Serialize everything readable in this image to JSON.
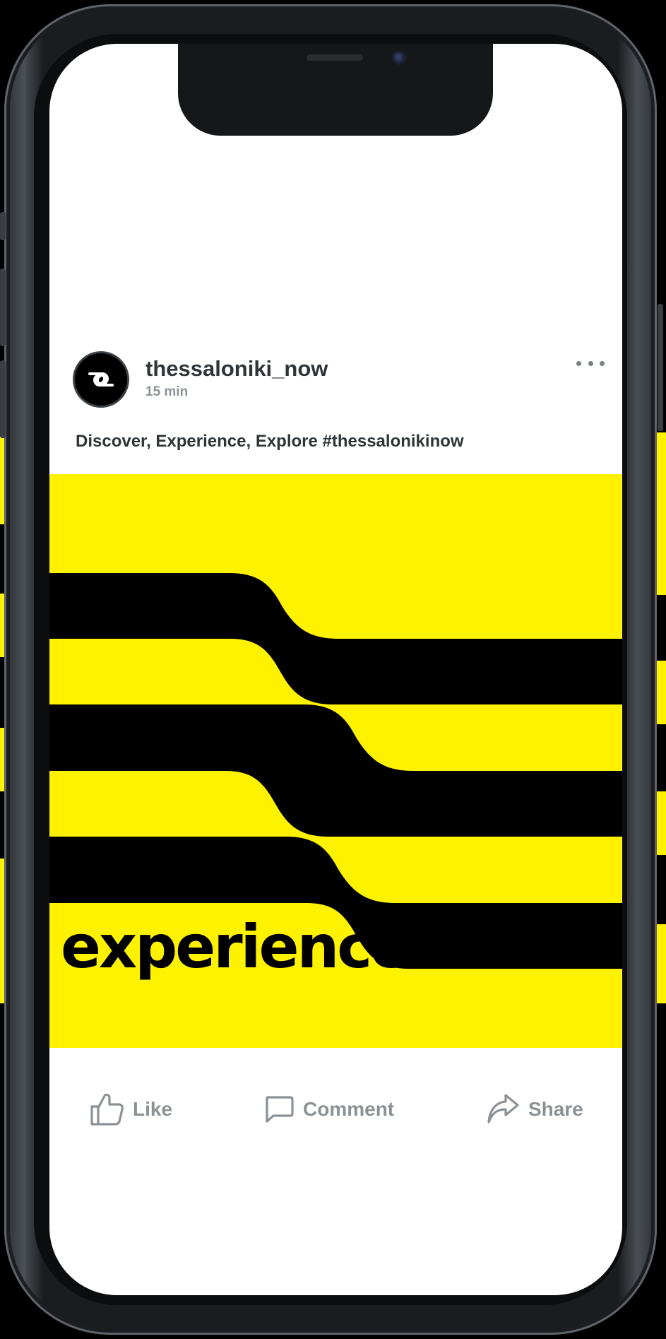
{
  "post": {
    "username": "thessaloniki_now",
    "timestamp": "15 min",
    "caption": "Discover, Experience, Explore #thessalonikinow",
    "image_word": "experience"
  },
  "actions": {
    "like_label": "Like",
    "comment_label": "Comment",
    "share_label": "Share"
  },
  "icons": {
    "avatar": "infinity-logo-icon",
    "more": "more-dots-icon",
    "like": "thumbs-up-icon",
    "comment": "speech-bubble-icon",
    "share": "share-arrow-icon"
  },
  "colors": {
    "image_background": "#fff200",
    "image_stripes": "#000000",
    "text_primary": "#2f3438",
    "text_muted": "#8c9196",
    "screen_background": "#ffffff"
  }
}
